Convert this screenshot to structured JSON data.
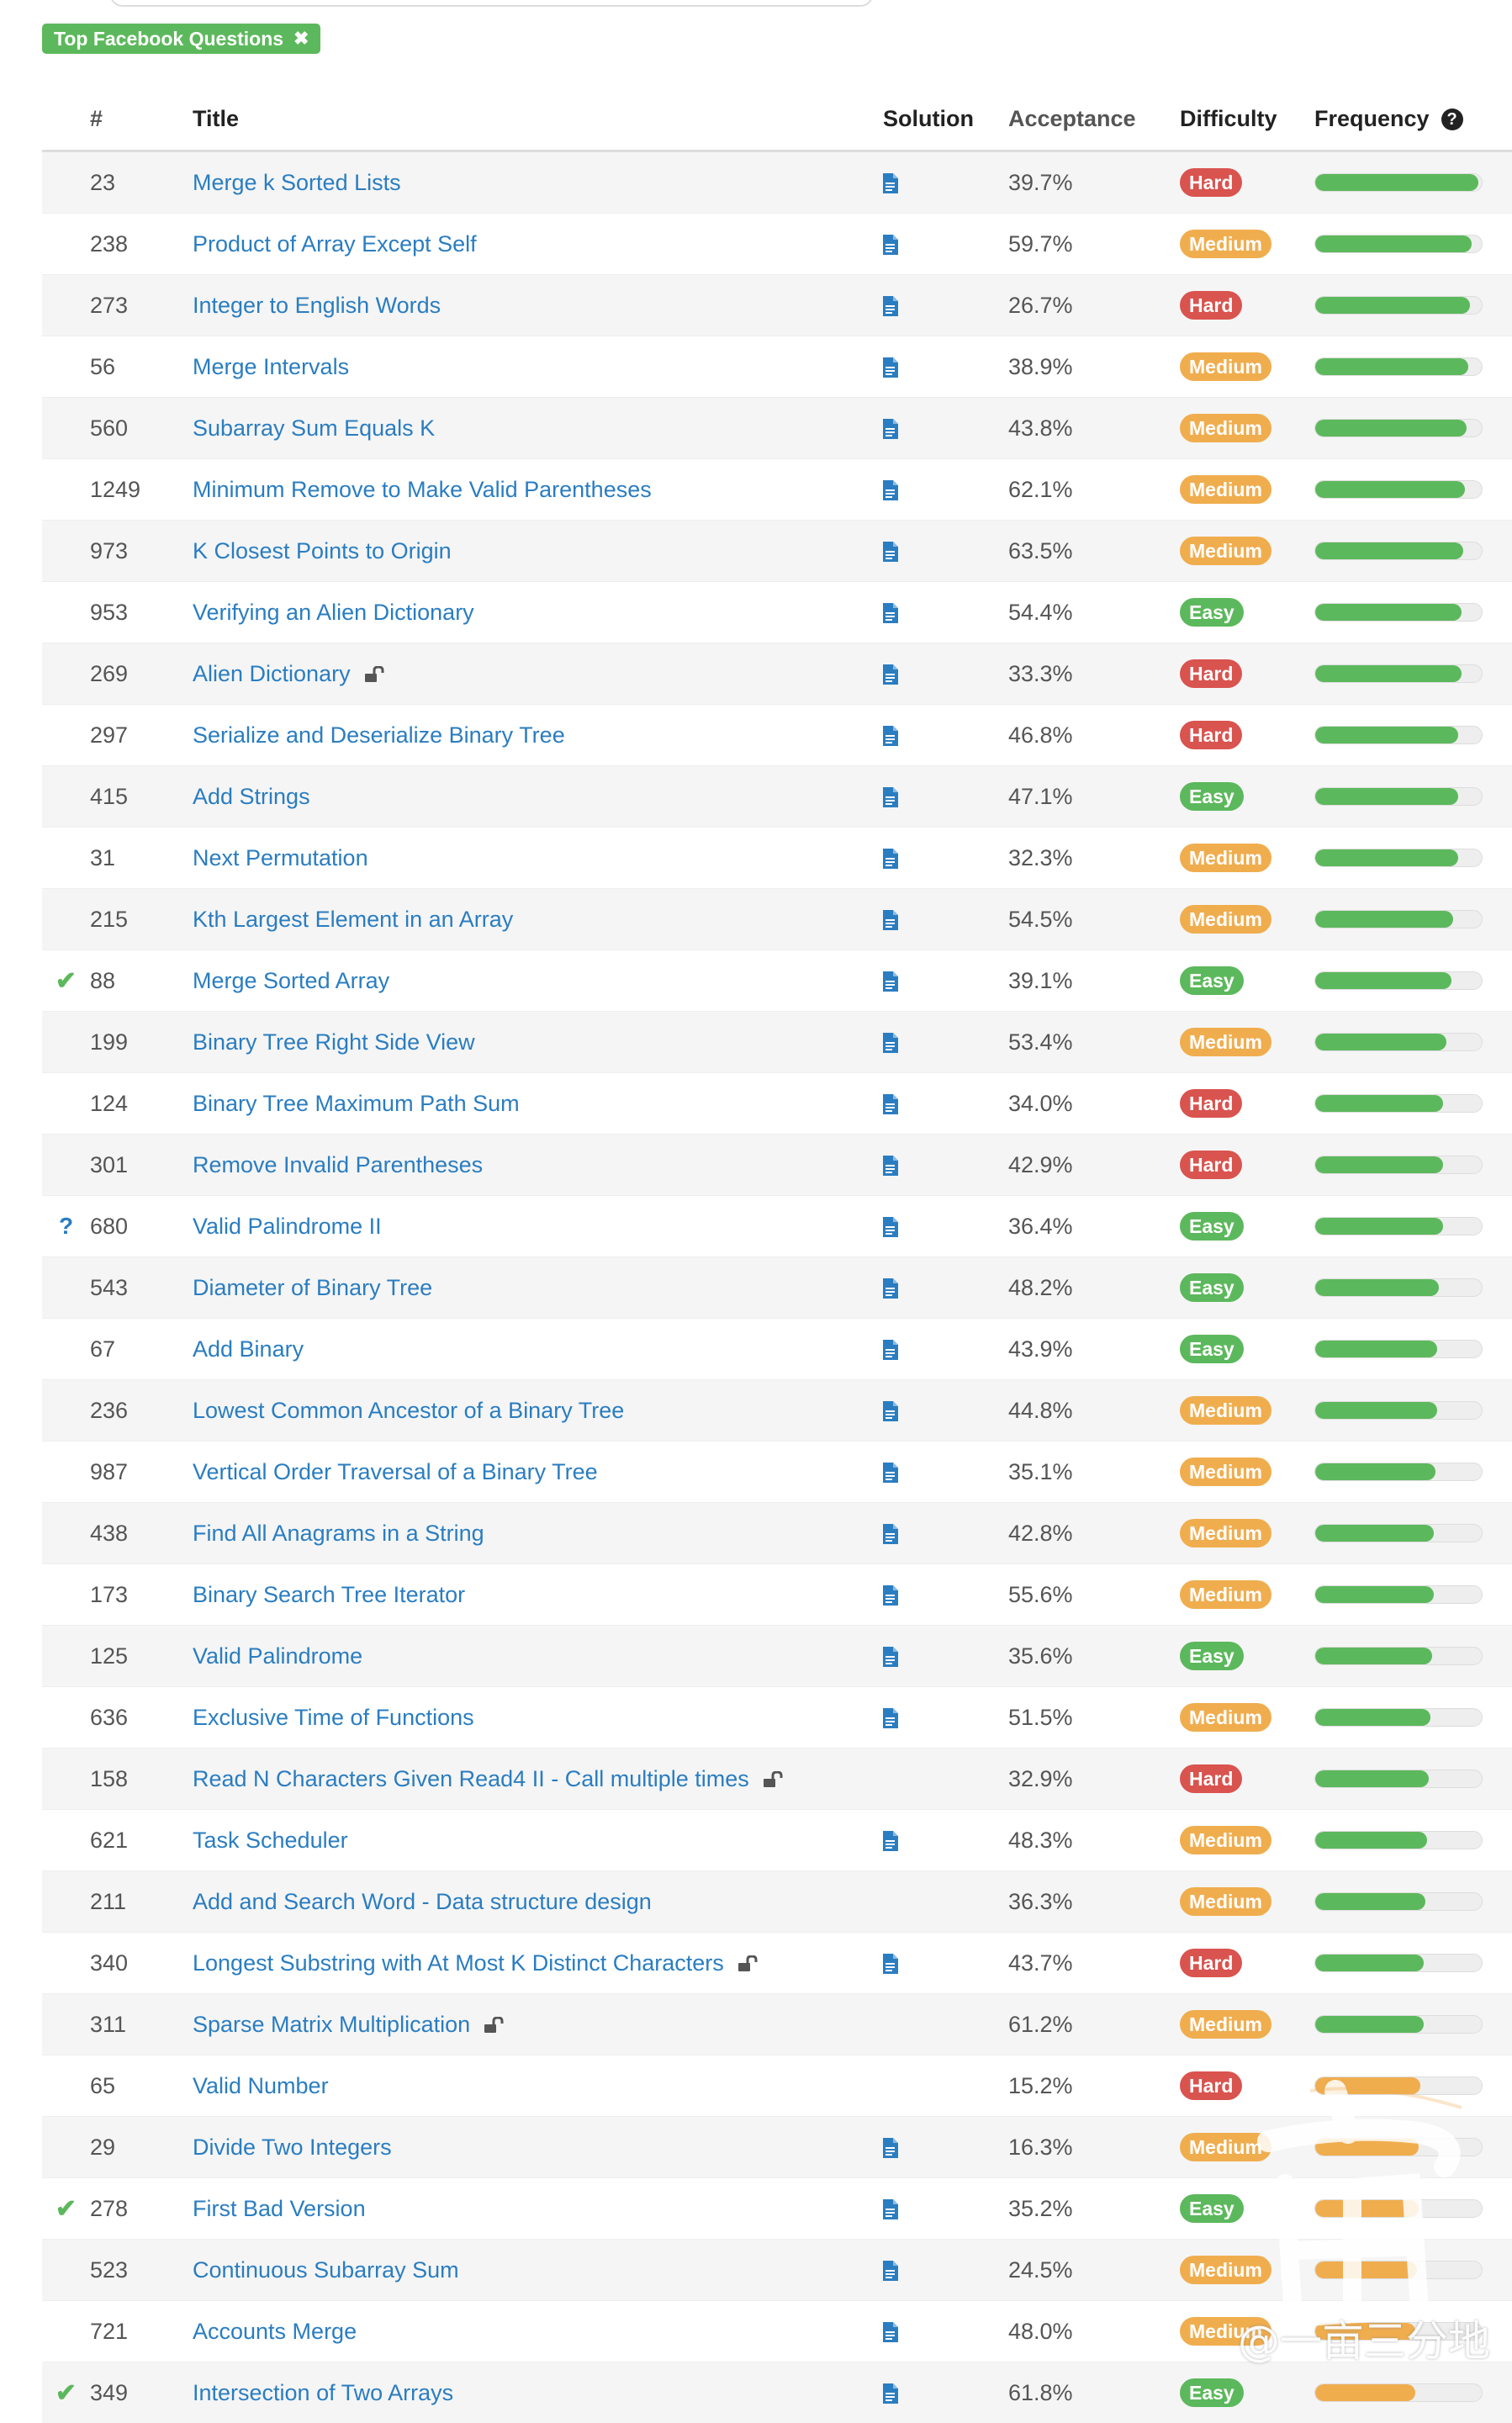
{
  "filter_tag": {
    "label": "Top Facebook Questions",
    "remove": "✖"
  },
  "columns": {
    "status": "",
    "num": "#",
    "title": "Title",
    "solution": "Solution",
    "acceptance": "Acceptance",
    "difficulty": "Difficulty",
    "frequency": "Frequency",
    "frequency_help": "?"
  },
  "rows": [
    {
      "status": "",
      "num": "23",
      "title": "Merge k Sorted Lists",
      "locked": false,
      "solution": true,
      "acceptance": "39.7%",
      "difficulty": "Hard",
      "frequency": 0.98
    },
    {
      "status": "",
      "num": "238",
      "title": "Product of Array Except Self",
      "locked": false,
      "solution": true,
      "acceptance": "59.7%",
      "difficulty": "Medium",
      "frequency": 0.94
    },
    {
      "status": "",
      "num": "273",
      "title": "Integer to English Words",
      "locked": false,
      "solution": true,
      "acceptance": "26.7%",
      "difficulty": "Hard",
      "frequency": 0.93
    },
    {
      "status": "",
      "num": "56",
      "title": "Merge Intervals",
      "locked": false,
      "solution": true,
      "acceptance": "38.9%",
      "difficulty": "Medium",
      "frequency": 0.92
    },
    {
      "status": "",
      "num": "560",
      "title": "Subarray Sum Equals K",
      "locked": false,
      "solution": true,
      "acceptance": "43.8%",
      "difficulty": "Medium",
      "frequency": 0.91
    },
    {
      "status": "",
      "num": "1249",
      "title": "Minimum Remove to Make Valid Parentheses",
      "locked": false,
      "solution": true,
      "acceptance": "62.1%",
      "difficulty": "Medium",
      "frequency": 0.9
    },
    {
      "status": "",
      "num": "973",
      "title": "K Closest Points to Origin",
      "locked": false,
      "solution": true,
      "acceptance": "63.5%",
      "difficulty": "Medium",
      "frequency": 0.89
    },
    {
      "status": "",
      "num": "953",
      "title": "Verifying an Alien Dictionary",
      "locked": false,
      "solution": true,
      "acceptance": "54.4%",
      "difficulty": "Easy",
      "frequency": 0.88
    },
    {
      "status": "",
      "num": "269",
      "title": "Alien Dictionary",
      "locked": true,
      "solution": true,
      "acceptance": "33.3%",
      "difficulty": "Hard",
      "frequency": 0.88
    },
    {
      "status": "",
      "num": "297",
      "title": "Serialize and Deserialize Binary Tree",
      "locked": false,
      "solution": true,
      "acceptance": "46.8%",
      "difficulty": "Hard",
      "frequency": 0.86
    },
    {
      "status": "",
      "num": "415",
      "title": "Add Strings",
      "locked": false,
      "solution": true,
      "acceptance": "47.1%",
      "difficulty": "Easy",
      "frequency": 0.86
    },
    {
      "status": "",
      "num": "31",
      "title": "Next Permutation",
      "locked": false,
      "solution": true,
      "acceptance": "32.3%",
      "difficulty": "Medium",
      "frequency": 0.86
    },
    {
      "status": "",
      "num": "215",
      "title": "Kth Largest Element in an Array",
      "locked": false,
      "solution": true,
      "acceptance": "54.5%",
      "difficulty": "Medium",
      "frequency": 0.83
    },
    {
      "status": "check",
      "num": "88",
      "title": "Merge Sorted Array",
      "locked": false,
      "solution": true,
      "acceptance": "39.1%",
      "difficulty": "Easy",
      "frequency": 0.82
    },
    {
      "status": "",
      "num": "199",
      "title": "Binary Tree Right Side View",
      "locked": false,
      "solution": true,
      "acceptance": "53.4%",
      "difficulty": "Medium",
      "frequency": 0.79
    },
    {
      "status": "",
      "num": "124",
      "title": "Binary Tree Maximum Path Sum",
      "locked": false,
      "solution": true,
      "acceptance": "34.0%",
      "difficulty": "Hard",
      "frequency": 0.77
    },
    {
      "status": "",
      "num": "301",
      "title": "Remove Invalid Parentheses",
      "locked": false,
      "solution": true,
      "acceptance": "42.9%",
      "difficulty": "Hard",
      "frequency": 0.77
    },
    {
      "status": "question",
      "num": "680",
      "title": "Valid Palindrome II",
      "locked": false,
      "solution": true,
      "acceptance": "36.4%",
      "difficulty": "Easy",
      "frequency": 0.77
    },
    {
      "status": "",
      "num": "543",
      "title": "Diameter of Binary Tree",
      "locked": false,
      "solution": true,
      "acceptance": "48.2%",
      "difficulty": "Easy",
      "frequency": 0.74
    },
    {
      "status": "",
      "num": "67",
      "title": "Add Binary",
      "locked": false,
      "solution": true,
      "acceptance": "43.9%",
      "difficulty": "Easy",
      "frequency": 0.73
    },
    {
      "status": "",
      "num": "236",
      "title": "Lowest Common Ancestor of a Binary Tree",
      "locked": false,
      "solution": true,
      "acceptance": "44.8%",
      "difficulty": "Medium",
      "frequency": 0.73
    },
    {
      "status": "",
      "num": "987",
      "title": "Vertical Order Traversal of a Binary Tree",
      "locked": false,
      "solution": true,
      "acceptance": "35.1%",
      "difficulty": "Medium",
      "frequency": 0.72
    },
    {
      "status": "",
      "num": "438",
      "title": "Find All Anagrams in a String",
      "locked": false,
      "solution": true,
      "acceptance": "42.8%",
      "difficulty": "Medium",
      "frequency": 0.71
    },
    {
      "status": "",
      "num": "173",
      "title": "Binary Search Tree Iterator",
      "locked": false,
      "solution": true,
      "acceptance": "55.6%",
      "difficulty": "Medium",
      "frequency": 0.71
    },
    {
      "status": "",
      "num": "125",
      "title": "Valid Palindrome",
      "locked": false,
      "solution": true,
      "acceptance": "35.6%",
      "difficulty": "Easy",
      "frequency": 0.7
    },
    {
      "status": "",
      "num": "636",
      "title": "Exclusive Time of Functions",
      "locked": false,
      "solution": true,
      "acceptance": "51.5%",
      "difficulty": "Medium",
      "frequency": 0.69
    },
    {
      "status": "",
      "num": "158",
      "title": "Read N Characters Given Read4 II - Call multiple times",
      "locked": true,
      "solution": false,
      "acceptance": "32.9%",
      "difficulty": "Hard",
      "frequency": 0.68
    },
    {
      "status": "",
      "num": "621",
      "title": "Task Scheduler",
      "locked": false,
      "solution": true,
      "acceptance": "48.3%",
      "difficulty": "Medium",
      "frequency": 0.67
    },
    {
      "status": "",
      "num": "211",
      "title": "Add and Search Word - Data structure design",
      "locked": false,
      "solution": false,
      "acceptance": "36.3%",
      "difficulty": "Medium",
      "frequency": 0.66
    },
    {
      "status": "",
      "num": "340",
      "title": "Longest Substring with At Most K Distinct Characters",
      "locked": true,
      "solution": true,
      "acceptance": "43.7%",
      "difficulty": "Hard",
      "frequency": 0.65
    },
    {
      "status": "",
      "num": "311",
      "title": "Sparse Matrix Multiplication",
      "locked": true,
      "solution": false,
      "acceptance": "61.2%",
      "difficulty": "Medium",
      "frequency": 0.65
    },
    {
      "status": "",
      "num": "65",
      "title": "Valid Number",
      "locked": false,
      "solution": false,
      "acceptance": "15.2%",
      "difficulty": "Hard",
      "frequency": 0.63
    },
    {
      "status": "",
      "num": "29",
      "title": "Divide Two Integers",
      "locked": false,
      "solution": true,
      "acceptance": "16.3%",
      "difficulty": "Medium",
      "frequency": 0.62
    },
    {
      "status": "check",
      "num": "278",
      "title": "First Bad Version",
      "locked": false,
      "solution": true,
      "acceptance": "35.2%",
      "difficulty": "Easy",
      "frequency": 0.62
    },
    {
      "status": "",
      "num": "523",
      "title": "Continuous Subarray Sum",
      "locked": false,
      "solution": true,
      "acceptance": "24.5%",
      "difficulty": "Medium",
      "frequency": 0.61
    },
    {
      "status": "",
      "num": "721",
      "title": "Accounts Merge",
      "locked": false,
      "solution": true,
      "acceptance": "48.0%",
      "difficulty": "Medium",
      "frequency": 0.6
    },
    {
      "status": "check",
      "num": "349",
      "title": "Intersection of Two Arrays",
      "locked": false,
      "solution": true,
      "acceptance": "61.8%",
      "difficulty": "Easy",
      "frequency": 0.6
    }
  ],
  "colors": {
    "link": "#2a7dc1",
    "hard": "#d9534f",
    "medium": "#f0ad4e",
    "easy": "#5cb85c",
    "freq_high": "#5cb85c",
    "freq_mid": "#f0ad4e"
  },
  "watermark": {
    "text": "@一亩三分地"
  }
}
